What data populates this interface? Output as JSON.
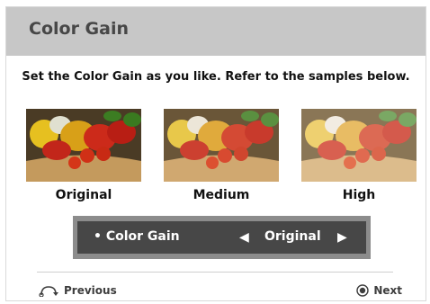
{
  "header": {
    "title": "Color Gain"
  },
  "instruction": "Set the Color Gain as you like. Refer to the samples below.",
  "samples": [
    {
      "label": "Original",
      "image": "vegetable-basket-photo"
    },
    {
      "label": "Medium",
      "image": "vegetable-basket-photo"
    },
    {
      "label": "High",
      "image": "vegetable-basket-photo"
    }
  ],
  "setting": {
    "label": "• Color Gain",
    "value": "Original",
    "left_arrow": "◀",
    "right_arrow": "▶"
  },
  "footer": {
    "previous": "Previous",
    "next": "Next"
  },
  "colors": {
    "header_bg": "#c7c7c7",
    "setting_bg": "#474747",
    "setting_border": "#8c8c8c"
  }
}
